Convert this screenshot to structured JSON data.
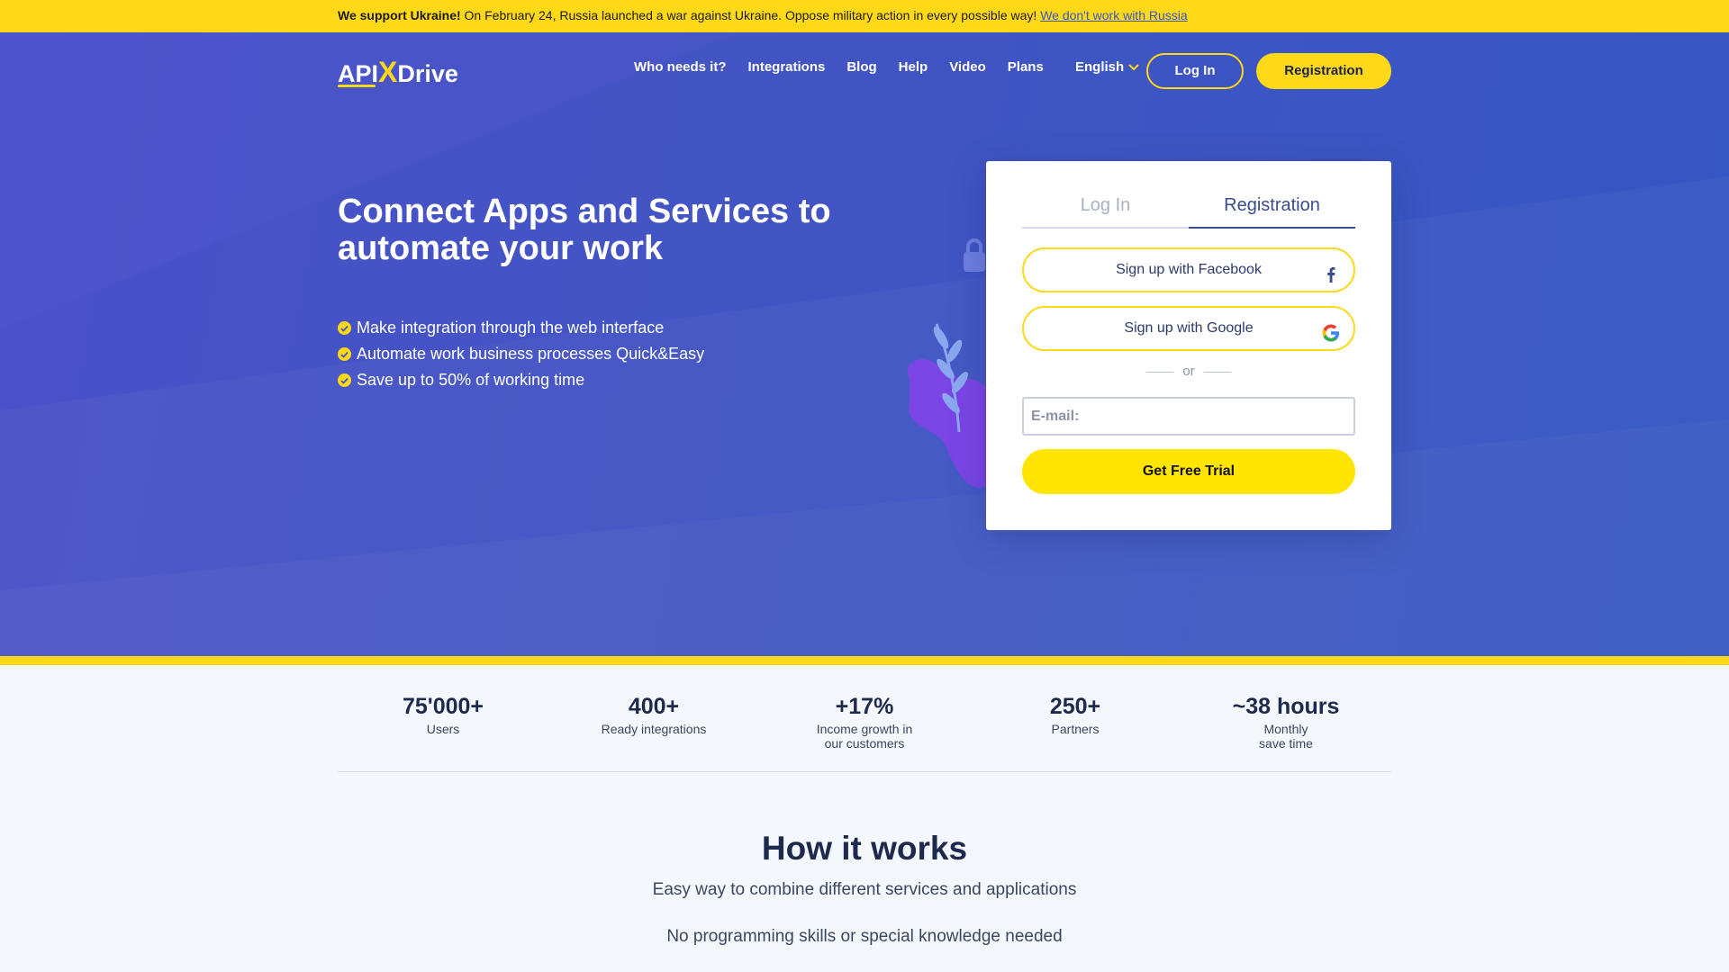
{
  "banner": {
    "bold": "We support Ukraine!",
    "text": " On February 24, Russia launched a war against Ukraine. Oppose military action in every possible way! ",
    "link": "We don't work with Russia"
  },
  "header": {
    "logo_left": "API",
    "logo_x": "X",
    "logo_right": "Drive",
    "nav": [
      "Who needs it?",
      "Integrations",
      "Blog",
      "Help",
      "Video",
      "Plans"
    ],
    "language": "English",
    "login": "Log In",
    "register": "Registration"
  },
  "hero": {
    "title": "Connect Apps and Services to automate your work",
    "features": [
      "Make integration through the web interface",
      "Automate work business processes Quick&Easy",
      "Save up to 50% of working time"
    ]
  },
  "auth_card": {
    "tab_login": "Log In",
    "tab_register": "Registration",
    "facebook": "Sign up with Facebook",
    "google": "Sign up with Google",
    "or": "or",
    "email_placeholder": "E-mail:",
    "cta": "Get Free Trial"
  },
  "stats": [
    {
      "num": "75'000+",
      "label": "Users"
    },
    {
      "num": "400+",
      "label": "Ready integrations"
    },
    {
      "num": "+17%",
      "label": "Income growth in our customers"
    },
    {
      "num": "250+",
      "label": "Partners"
    },
    {
      "num": "~38 hours",
      "label": "Monthly save time"
    }
  ],
  "how": {
    "title": "How it works",
    "subtitle1": "Easy way to combine different services and applications",
    "subtitle2": "No programming skills or special knowledge needed"
  },
  "colors": {
    "accent": "#ffd817",
    "hero_bg": "#4254c4",
    "dark_text": "#1d2a4d"
  }
}
